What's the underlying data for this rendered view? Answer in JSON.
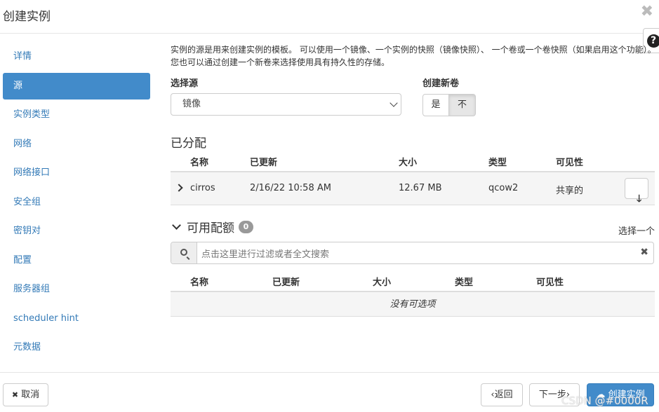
{
  "dialog": {
    "title": "创建实例",
    "close_glyph": "✖",
    "help_glyph": "?"
  },
  "sidebar": {
    "items": [
      {
        "label": "详情"
      },
      {
        "label": "源"
      },
      {
        "label": "实例类型"
      },
      {
        "label": "网络"
      },
      {
        "label": "网络接口"
      },
      {
        "label": "安全组"
      },
      {
        "label": "密钥对"
      },
      {
        "label": "配置"
      },
      {
        "label": "服务器组"
      },
      {
        "label": "scheduler hint"
      },
      {
        "label": "元数据"
      }
    ],
    "active_index": 1
  },
  "source": {
    "description": "实例的源是用来创建实例的模板。 可以使用一个镜像、一个实例的快照（镜像快照）、 一个卷或一个卷快照（如果启用这个功能）。 您也可以通过创建一个新卷来选择使用具有持久性的存储。",
    "select_source_label": "选择源",
    "select_source_value": "镜像",
    "create_volume_label": "创建新卷",
    "create_volume_yes": "是",
    "create_volume_no": "不"
  },
  "allocated": {
    "title": "已分配",
    "columns": [
      "名称",
      "已更新",
      "大小",
      "类型",
      "可见性"
    ],
    "rows": [
      {
        "name": "cirros",
        "updated": "2/16/22 10:58 AM",
        "size": "12.67 MB",
        "type": "qcow2",
        "visibility": "共享的",
        "action_glyph": "🡓"
      }
    ]
  },
  "available": {
    "title": "可用配额",
    "count": "0",
    "select_one": "选择一个",
    "search_placeholder": "点击这里进行过滤或者全文搜索",
    "columns": [
      "名称",
      "已更新",
      "大小",
      "类型",
      "可见性"
    ],
    "empty_text": "没有可选项"
  },
  "footer": {
    "cancel_label": "取消",
    "back_label": "‹返回",
    "next_label": "下一步›",
    "create_label": "创建实例"
  },
  "watermark": "CSDN @#0000R",
  "colors": {
    "primary": "#428bca",
    "link": "#337ab7"
  }
}
